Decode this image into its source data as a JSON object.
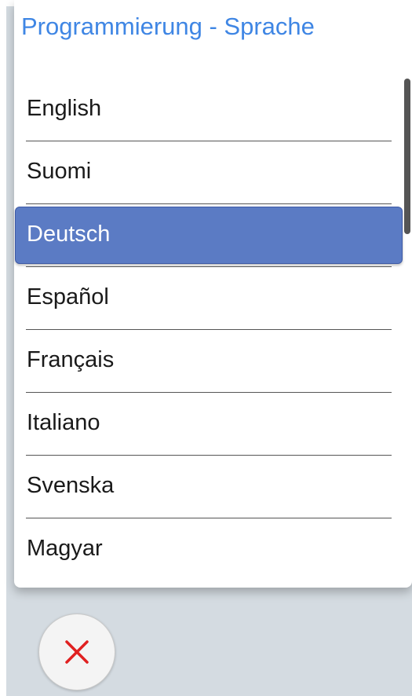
{
  "dialog": {
    "title": "Programmierung - Sprache"
  },
  "languages": [
    {
      "label": "English",
      "selected": false
    },
    {
      "label": "Suomi",
      "selected": false
    },
    {
      "label": "Deutsch",
      "selected": true
    },
    {
      "label": "Español",
      "selected": false
    },
    {
      "label": "Français",
      "selected": false
    },
    {
      "label": "Italiano",
      "selected": false
    },
    {
      "label": "Svenska",
      "selected": false
    },
    {
      "label": "Magyar",
      "selected": false
    }
  ],
  "footer": {
    "close_icon": "close-icon"
  },
  "colors": {
    "title": "#3f86e4",
    "selection": "#5b7bc4",
    "close": "#e02020",
    "background": "#d4dbe1"
  }
}
